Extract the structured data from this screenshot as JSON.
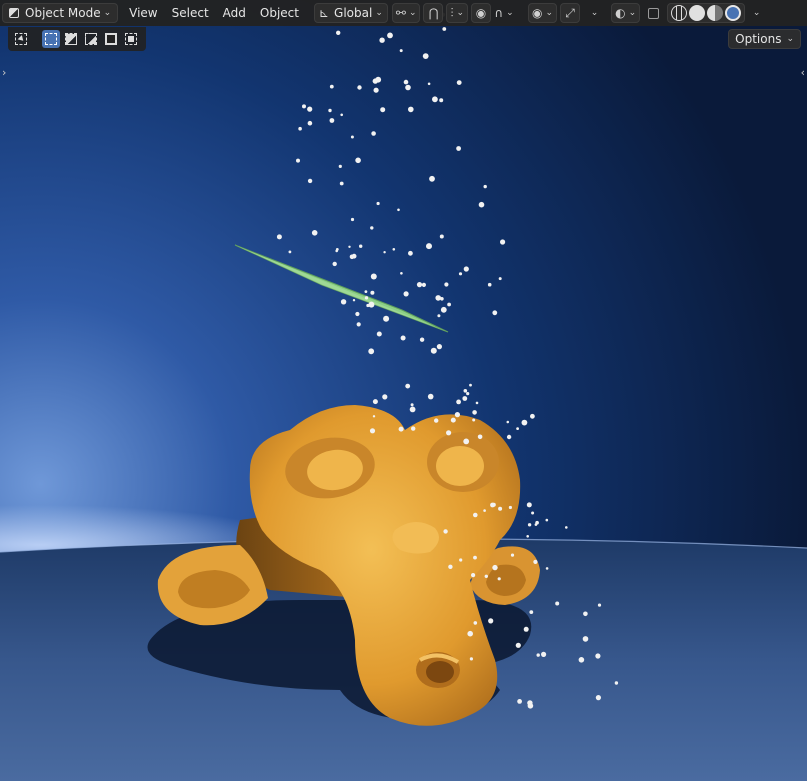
{
  "header": {
    "mode_label": "Object Mode",
    "menus": [
      "View",
      "Select",
      "Add",
      "Object"
    ],
    "transform_orientation": "Global",
    "icons": [
      "mode-icon",
      "pivot-icon",
      "snap-icon",
      "snap-increment-icon",
      "proportional-edit-icon",
      "falloff-curve-icon",
      "visibility-icon",
      "gizmo-icon",
      "overlay-icon",
      "xray-icon",
      "shading-wireframe-icon",
      "shading-solid-icon",
      "shading-material-icon",
      "shading-rendered-icon"
    ]
  },
  "toolbar": {
    "select_modes": [
      "select-new-icon",
      "select-extend-icon",
      "select-subtract-icon",
      "select-invert-icon",
      "select-intersect-icon"
    ]
  },
  "options_label": "Options",
  "colors": {
    "header_bg": "#222222",
    "accent": "#4772b3",
    "monkey": "#e3a43a",
    "plane": "#8ccf86",
    "floor": "#2f4a78",
    "sky_glow": "#3f6ec0"
  },
  "scene": {
    "objects": [
      "Suzanne",
      "Plane",
      "Particles"
    ]
  }
}
